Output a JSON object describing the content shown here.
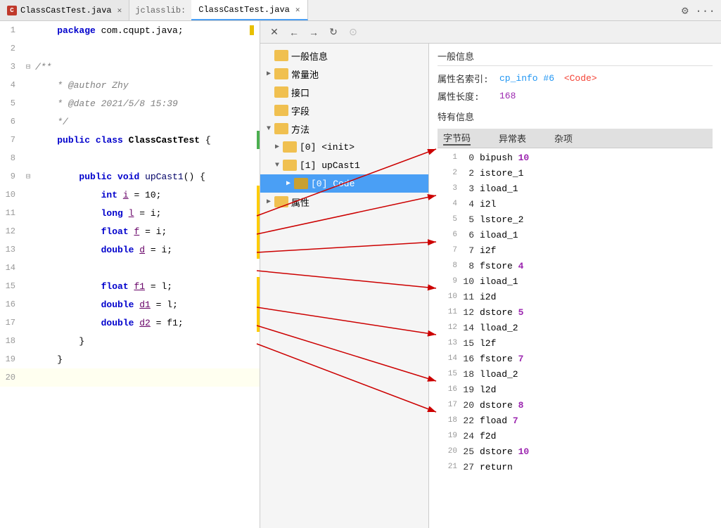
{
  "tabs": {
    "left": {
      "icon": "C",
      "label": "ClassCastTest.java",
      "active": false
    },
    "right_label": "jclasslib:",
    "right": {
      "label": "ClassCastTest.java",
      "active": true
    }
  },
  "toolbar": {
    "close": "✕",
    "back": "←",
    "forward": "→",
    "refresh": "↻",
    "browser": "⊙"
  },
  "tree": {
    "items": [
      {
        "level": 0,
        "arrow": "",
        "label": "一般信息",
        "selected": false,
        "id": "general-info"
      },
      {
        "level": 0,
        "arrow": "▶",
        "label": "常量池",
        "selected": false,
        "id": "const-pool"
      },
      {
        "level": 0,
        "arrow": "",
        "label": "接口",
        "selected": false,
        "id": "interface"
      },
      {
        "level": 0,
        "arrow": "",
        "label": "字段",
        "selected": false,
        "id": "fields"
      },
      {
        "level": 0,
        "arrow": "▼",
        "label": "方法",
        "selected": false,
        "id": "methods"
      },
      {
        "level": 1,
        "arrow": "▶",
        "label": "[0] <init>",
        "selected": false,
        "id": "method-init"
      },
      {
        "level": 1,
        "arrow": "▼",
        "label": "[1] upCast1",
        "selected": false,
        "id": "method-upcast1"
      },
      {
        "level": 2,
        "arrow": "▶",
        "label": "[0] Code",
        "selected": true,
        "id": "code-attr"
      },
      {
        "level": 0,
        "arrow": "▶",
        "label": "属性",
        "selected": false,
        "id": "attributes"
      }
    ]
  },
  "info": {
    "section1_title": "一般信息",
    "attr_name_label": "属性名索引:",
    "attr_name_link": "cp_info #6",
    "attr_name_value": "<Code>",
    "attr_len_label": "属性长度:",
    "attr_len_value": "168",
    "section2_title": "特有信息",
    "table_headers": [
      "字节码",
      "异常表",
      "杂项"
    ],
    "bytecode": [
      {
        "line": "1",
        "offset": "0",
        "instr": "bipush ",
        "arg": "10",
        "arg_colored": true
      },
      {
        "line": "2",
        "offset": "2",
        "instr": "istore_1",
        "arg": "",
        "arg_colored": false
      },
      {
        "line": "3",
        "offset": "3",
        "instr": "iload_1",
        "arg": "",
        "arg_colored": false
      },
      {
        "line": "4",
        "offset": "4",
        "instr": "i2l",
        "arg": "",
        "arg_colored": false
      },
      {
        "line": "5",
        "offset": "5",
        "instr": "lstore_2",
        "arg": "",
        "arg_colored": false
      },
      {
        "line": "6",
        "offset": "6",
        "instr": "iload_1",
        "arg": "",
        "arg_colored": false
      },
      {
        "line": "7",
        "offset": "7",
        "instr": "i2f",
        "arg": "",
        "arg_colored": false
      },
      {
        "line": "8",
        "offset": "8",
        "instr": "fstore ",
        "arg": "4",
        "arg_colored": true
      },
      {
        "line": "9",
        "offset": "10",
        "instr": "iload_1",
        "arg": "",
        "arg_colored": false
      },
      {
        "line": "10",
        "offset": "11",
        "instr": "i2d",
        "arg": "",
        "arg_colored": false
      },
      {
        "line": "11",
        "offset": "12",
        "instr": "dstore ",
        "arg": "5",
        "arg_colored": true
      },
      {
        "line": "12",
        "offset": "14",
        "instr": "lload_2",
        "arg": "",
        "arg_colored": false
      },
      {
        "line": "13",
        "offset": "15",
        "instr": "l2f",
        "arg": "",
        "arg_colored": false
      },
      {
        "line": "14",
        "offset": "16",
        "instr": "fstore ",
        "arg": "7",
        "arg_colored": true
      },
      {
        "line": "15",
        "offset": "18",
        "instr": "lload_2",
        "arg": "",
        "arg_colored": false
      },
      {
        "line": "16",
        "offset": "19",
        "instr": "l2d",
        "arg": "",
        "arg_colored": false
      },
      {
        "line": "17",
        "offset": "20",
        "instr": "dstore ",
        "arg": "8",
        "arg_colored": true
      },
      {
        "line": "18",
        "offset": "22",
        "instr": "fload ",
        "arg": "7",
        "arg_colored": true
      },
      {
        "line": "19",
        "offset": "24",
        "instr": "f2d",
        "arg": "",
        "arg_colored": false
      },
      {
        "line": "20",
        "offset": "25",
        "instr": "dstore ",
        "arg": "10",
        "arg_colored": true
      },
      {
        "line": "21",
        "offset": "27",
        "instr": "return",
        "arg": "",
        "arg_colored": false
      }
    ]
  },
  "code": {
    "lines": [
      {
        "num": 1,
        "text": "    package com.cqupt.java;",
        "bookmark": true,
        "change": ""
      },
      {
        "num": 2,
        "text": "",
        "bookmark": false,
        "change": ""
      },
      {
        "num": 3,
        "text": "    /**",
        "bookmark": false,
        "change": ""
      },
      {
        "num": 4,
        "text": "     * @author Zhy",
        "bookmark": false,
        "change": ""
      },
      {
        "num": 5,
        "text": "     * @date 2021/5/8 15:39",
        "bookmark": false,
        "change": ""
      },
      {
        "num": 6,
        "text": "     */",
        "bookmark": false,
        "change": ""
      },
      {
        "num": 7,
        "text": "    public class ClassCastTest {",
        "bookmark": false,
        "change": "yellow"
      },
      {
        "num": 8,
        "text": "",
        "bookmark": false,
        "change": ""
      },
      {
        "num": 9,
        "text": "        public void upCast1() {",
        "bookmark": false,
        "change": ""
      },
      {
        "num": 10,
        "text": "            int i = 10;",
        "bookmark": false,
        "change": "yellow"
      },
      {
        "num": 11,
        "text": "            long l = i;",
        "bookmark": false,
        "change": "yellow"
      },
      {
        "num": 12,
        "text": "            float f = i;",
        "bookmark": false,
        "change": "yellow"
      },
      {
        "num": 13,
        "text": "            double d = i;",
        "bookmark": false,
        "change": "yellow"
      },
      {
        "num": 14,
        "text": "",
        "bookmark": false,
        "change": ""
      },
      {
        "num": 15,
        "text": "            float f1 = l;",
        "bookmark": false,
        "change": "yellow"
      },
      {
        "num": 16,
        "text": "            double d1 = l;",
        "bookmark": false,
        "change": "yellow"
      },
      {
        "num": 17,
        "text": "            double d2 = f1;",
        "bookmark": false,
        "change": "yellow"
      },
      {
        "num": 18,
        "text": "        }",
        "bookmark": false,
        "change": ""
      },
      {
        "num": 19,
        "text": "    }",
        "bookmark": false,
        "change": ""
      },
      {
        "num": 20,
        "text": "",
        "bookmark": false,
        "change": ""
      }
    ]
  }
}
